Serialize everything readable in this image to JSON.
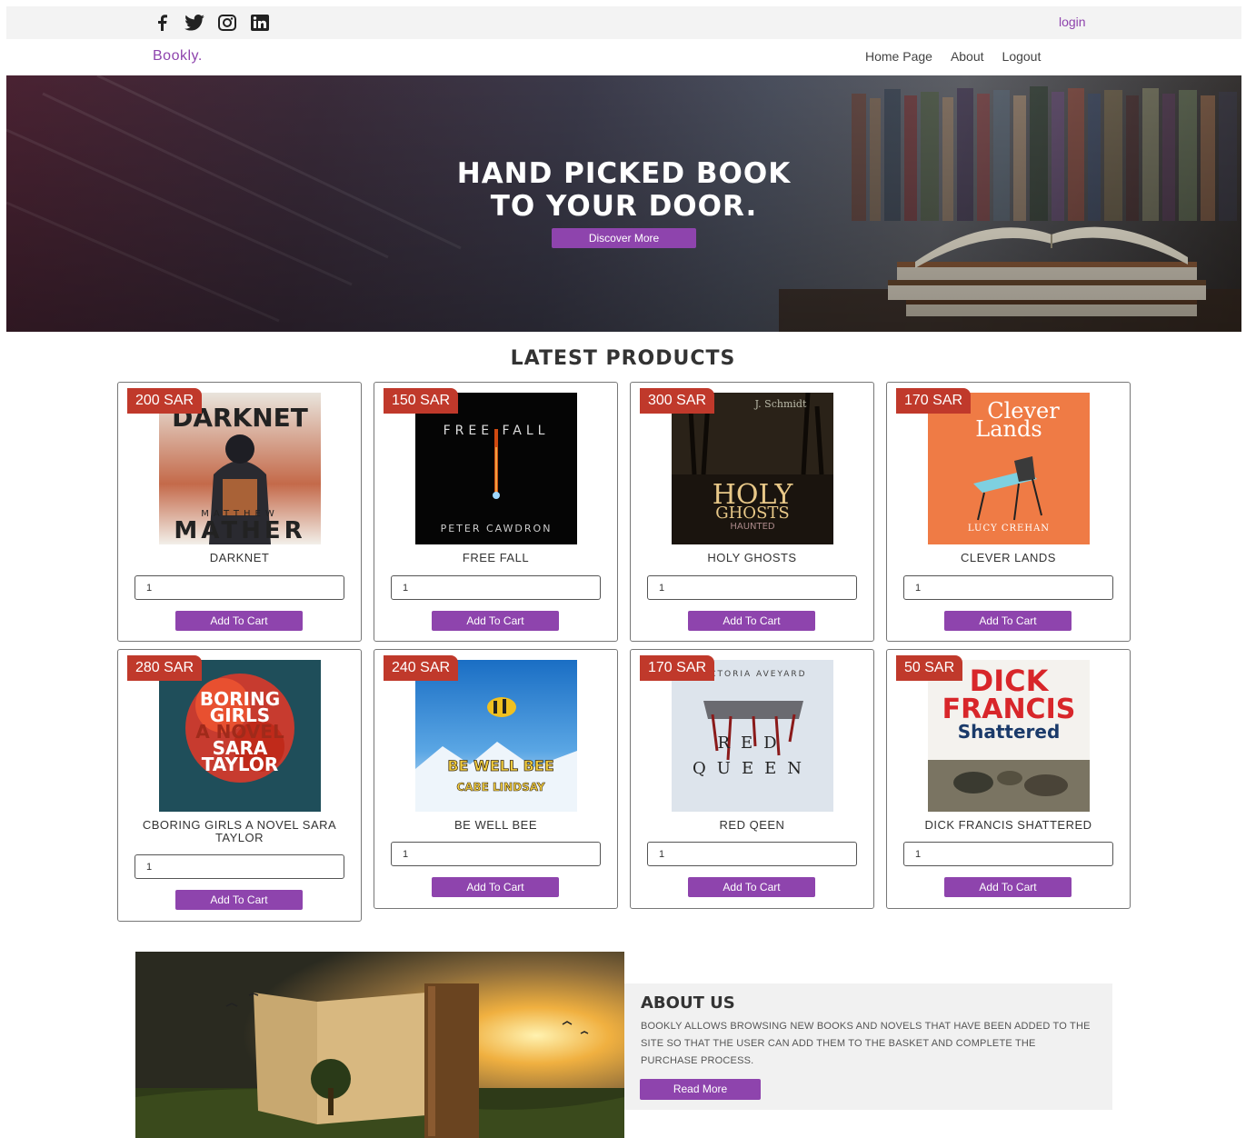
{
  "topbar": {
    "social_icons": [
      "facebook-icon",
      "twitter-icon",
      "instagram-icon",
      "linkedin-icon"
    ],
    "login_label": "login"
  },
  "nav": {
    "logo": "Bookly.",
    "links": [
      "Home Page",
      "About",
      "Logout"
    ]
  },
  "hero": {
    "title_line1": "HAND PICKED BOOK",
    "title_line2": "TO YOUR DOOR.",
    "button_label": "Discover More"
  },
  "products": {
    "section_title": "LATEST PRODUCTS",
    "add_to_cart_label": "Add To Cart",
    "items": [
      {
        "price": "200 SAR",
        "name": "DARKNET",
        "qty": "1"
      },
      {
        "price": "150 SAR",
        "name": "FREE FALL",
        "qty": "1"
      },
      {
        "price": "300 SAR",
        "name": "HOLY GHOSTS",
        "qty": "1"
      },
      {
        "price": "170 SAR",
        "name": "CLEVER LANDS",
        "qty": "1"
      },
      {
        "price": "280 SAR",
        "name": "CBORING GIRLS A NOVEL SARA TAYLOR",
        "qty": "1"
      },
      {
        "price": "240 SAR",
        "name": "BE WELL BEE",
        "qty": "1"
      },
      {
        "price": "170 SAR",
        "name": "RED QEEN",
        "qty": "1"
      },
      {
        "price": "50 SAR",
        "name": "DICK FRANCIS SHATTERED",
        "qty": "1"
      }
    ]
  },
  "covers": [
    {
      "lines": [
        "DARKNET",
        "MATTHEW",
        "MATHER"
      ]
    },
    {
      "lines": [
        "FREE FALL",
        "PETER CAWDRON"
      ]
    },
    {
      "lines": [
        "J. Schmidt",
        "HOLY",
        "GHOSTS",
        "HAUNTED"
      ]
    },
    {
      "lines": [
        "Clever",
        "Lands",
        "LUCY CREHAN"
      ]
    },
    {
      "lines": [
        "BORING",
        "GIRLS",
        "A NOVEL",
        "SARA",
        "TAYLOR"
      ]
    },
    {
      "lines": [
        "BE WELL BEE",
        "CABE LINDSAY"
      ]
    },
    {
      "lines": [
        "VICTORIA AVEYARD",
        "RED",
        "QUEEN"
      ]
    },
    {
      "lines": [
        "DICK",
        "FRANCIS",
        "Shattered"
      ]
    }
  ],
  "about": {
    "title": "ABOUT US",
    "text": "BOOKLY ALLOWS BROWSING NEW BOOKS AND NOVELS THAT HAVE BEEN ADDED TO THE SITE SO THAT THE USER CAN ADD THEM TO THE BASKET AND COMPLETE THE PURCHASE PROCESS.",
    "button_label": "Read More"
  },
  "colors": {
    "accent": "#8e44ad",
    "badge": "#c0392b"
  }
}
